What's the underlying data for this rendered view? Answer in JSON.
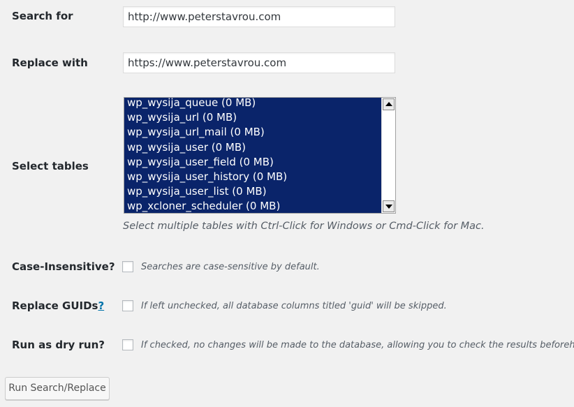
{
  "search": {
    "label": "Search for",
    "value": "http://www.peterstavrou.com"
  },
  "replace": {
    "label": "Replace with",
    "value": "https://www.peterstavrou.com"
  },
  "tables": {
    "label": "Select tables",
    "options": [
      "wp_wysija_queue (0 MB)",
      "wp_wysija_url (0 MB)",
      "wp_wysija_url_mail (0 MB)",
      "wp_wysija_user (0 MB)",
      "wp_wysija_user_field (0 MB)",
      "wp_wysija_user_history (0 MB)",
      "wp_wysija_user_list (0 MB)",
      "wp_xcloner_scheduler (0 MB)"
    ],
    "help": "Select multiple tables with Ctrl-Click for Windows or Cmd-Click for Mac."
  },
  "case_insensitive": {
    "label": "Case-Insensitive?",
    "description": "Searches are case-sensitive by default.",
    "checked": false
  },
  "replace_guids": {
    "label": "Replace GUIDs",
    "help_link": "?",
    "description": "If left unchecked, all database columns titled 'guid' will be skipped.",
    "checked": false
  },
  "dry_run": {
    "label": "Run as dry run?",
    "description": "If checked, no changes will be made to the database, allowing you to check the results beforehand.",
    "checked": false
  },
  "submit": {
    "label": "Run Search/Replace"
  },
  "colors": {
    "selection_bg": "#0a246a",
    "link": "#0073aa",
    "page_bg": "#f1f1f1"
  }
}
